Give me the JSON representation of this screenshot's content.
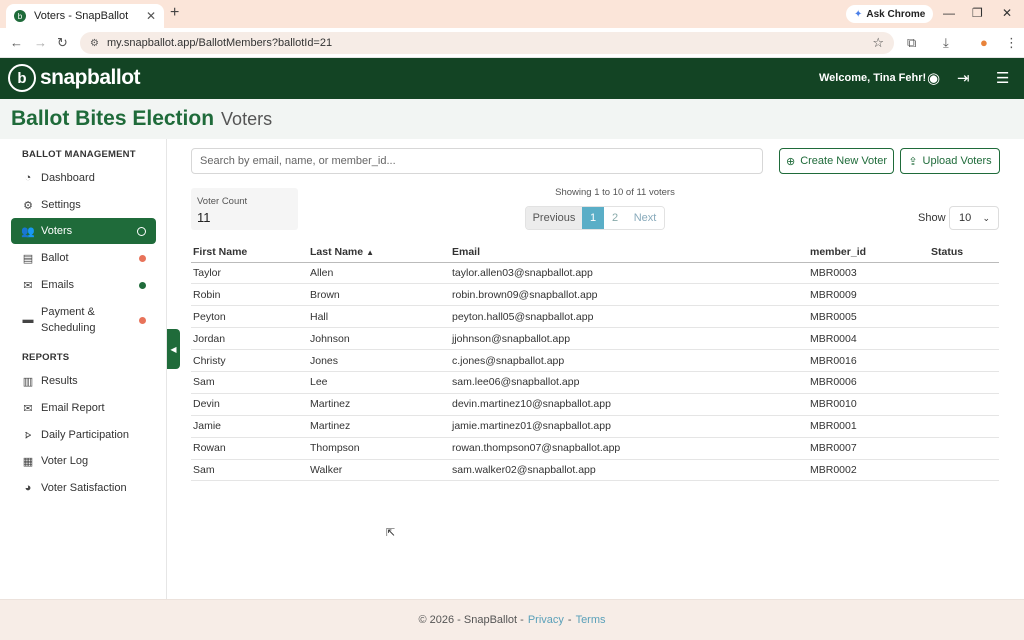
{
  "browser": {
    "tab_title": "Voters - SnapBallot",
    "new_tab": "+",
    "ask_chrome": "Ask Chrome",
    "url": "my.snapballot.app/BallotMembers?ballotId=21"
  },
  "header": {
    "brand": "snapballot",
    "welcome": "Welcome, Tina Fehr!"
  },
  "page": {
    "election": "Ballot Bites Election",
    "subtitle": "Voters"
  },
  "sidebar": {
    "section_management": "BALLOT MANAGEMENT",
    "section_reports": "REPORTS",
    "items": [
      {
        "label": "Dashboard",
        "icon": "gauge-icon"
      },
      {
        "label": "Settings",
        "icon": "gear-icon"
      },
      {
        "label": "Voters",
        "icon": "users-icon",
        "active": true
      },
      {
        "label": "Ballot",
        "icon": "file-icon",
        "status_color": "#e8735a"
      },
      {
        "label": "Emails",
        "icon": "envelope-icon",
        "status_color": "#1f6b3a"
      },
      {
        "label": "Payment &",
        "label2": "Scheduling",
        "icon": "card-icon",
        "status_color": "#e8735a"
      }
    ],
    "reports": [
      {
        "label": "Results",
        "icon": "bar-chart-icon"
      },
      {
        "label": "Email Report",
        "icon": "mail-report-icon"
      },
      {
        "label": "Daily Participation",
        "icon": "line-chart-icon"
      },
      {
        "label": "Voter Log",
        "icon": "calendar-icon"
      },
      {
        "label": "Voter Satisfaction",
        "icon": "pie-chart-icon"
      }
    ]
  },
  "toolbar": {
    "search_placeholder": "Search by email, name, or member_id...",
    "create_label": "Create New Voter",
    "upload_label": "Upload Voters"
  },
  "stats": {
    "voter_count_label": "Voter Count",
    "voter_count": "11"
  },
  "pagination": {
    "showing": "Showing 1 to 10 of 11 voters",
    "previous": "Previous",
    "current": "1",
    "page2": "2",
    "next": "Next",
    "show_label": "Show",
    "show_value": "10"
  },
  "table": {
    "columns": [
      "First Name",
      "Last Name",
      "Email",
      "member_id",
      "Status"
    ],
    "rows": [
      [
        "Taylor",
        "Allen",
        "taylor.allen03@snapballot.app",
        "MBR0003",
        ""
      ],
      [
        "Robin",
        "Brown",
        "robin.brown09@snapballot.app",
        "MBR0009",
        ""
      ],
      [
        "Peyton",
        "Hall",
        "peyton.hall05@snapballot.app",
        "MBR0005",
        ""
      ],
      [
        "Jordan",
        "Johnson",
        "jjohnson@snapballot.app",
        "MBR0004",
        ""
      ],
      [
        "Christy",
        "Jones",
        "c.jones@snapballot.app",
        "MBR0016",
        ""
      ],
      [
        "Sam",
        "Lee",
        "sam.lee06@snapballot.app",
        "MBR0006",
        ""
      ],
      [
        "Devin",
        "Martinez",
        "devin.martinez10@snapballot.app",
        "MBR0010",
        ""
      ],
      [
        "Jamie",
        "Martinez",
        "jamie.martinez01@snapballot.app",
        "MBR0001",
        ""
      ],
      [
        "Rowan",
        "Thompson",
        "rowan.thompson07@snapballot.app",
        "MBR0007",
        ""
      ],
      [
        "Sam",
        "Walker",
        "sam.walker02@snapballot.app",
        "MBR0002",
        ""
      ]
    ]
  },
  "footer": {
    "copyright": "© 2026 - SnapBallot -",
    "privacy": "Privacy",
    "dash": "-",
    "terms": "Terms"
  },
  "colors": {
    "brand_dark": "#134424",
    "brand": "#1f6b3a",
    "accent_blue": "#5aaec7",
    "status_red": "#e8735a"
  }
}
